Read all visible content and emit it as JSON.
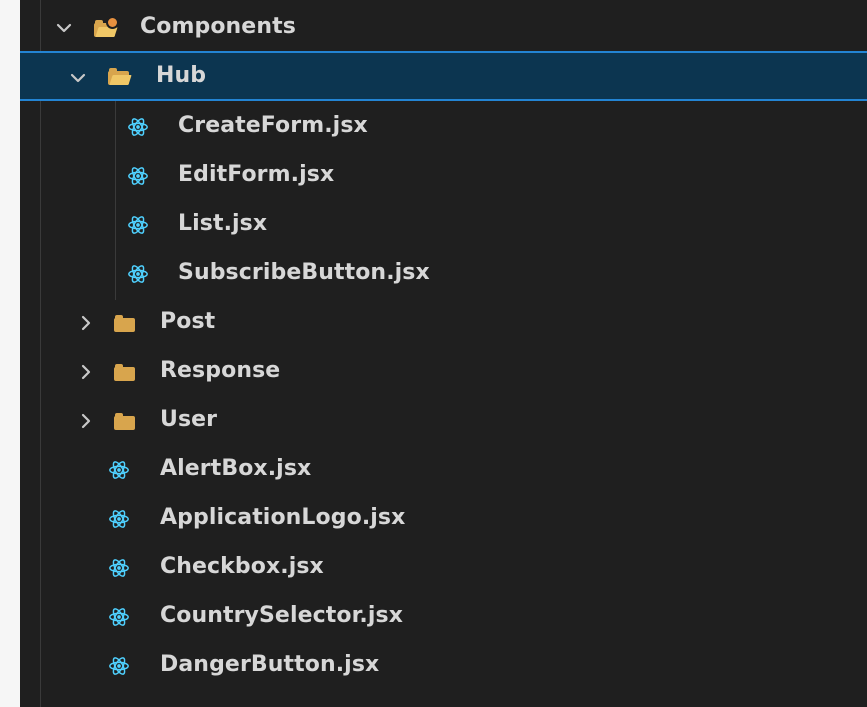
{
  "explorer": {
    "tree": [
      {
        "label": "Components",
        "type": "folder",
        "expanded": true,
        "icon": "components-folder-icon"
      },
      {
        "label": "Hub",
        "type": "folder",
        "expanded": true,
        "selected": true,
        "icon": "folder-open-icon"
      },
      {
        "label": "CreateForm.jsx",
        "type": "file",
        "icon": "react-icon"
      },
      {
        "label": "EditForm.jsx",
        "type": "file",
        "icon": "react-icon"
      },
      {
        "label": "List.jsx",
        "type": "file",
        "icon": "react-icon"
      },
      {
        "label": "SubscribeButton.jsx",
        "type": "file",
        "icon": "react-icon"
      },
      {
        "label": "Post",
        "type": "folder",
        "expanded": false,
        "icon": "folder-icon"
      },
      {
        "label": "Response",
        "type": "folder",
        "expanded": false,
        "icon": "folder-icon"
      },
      {
        "label": "User",
        "type": "folder",
        "expanded": false,
        "icon": "folder-icon"
      },
      {
        "label": "AlertBox.jsx",
        "type": "file",
        "icon": "react-icon"
      },
      {
        "label": "ApplicationLogo.jsx",
        "type": "file",
        "icon": "react-icon"
      },
      {
        "label": "Checkbox.jsx",
        "type": "file",
        "icon": "react-icon"
      },
      {
        "label": "CountrySelector.jsx",
        "type": "file",
        "icon": "react-icon"
      },
      {
        "label": "DangerButton.jsx",
        "type": "file",
        "icon": "react-icon"
      }
    ]
  },
  "colors": {
    "background": "#1f1f1f",
    "selection_background": "#0c3550",
    "selection_border": "#2384d3",
    "text": "#d7d7d7",
    "react_icon": "#4fd1ff",
    "folder": "#d8a54d"
  }
}
